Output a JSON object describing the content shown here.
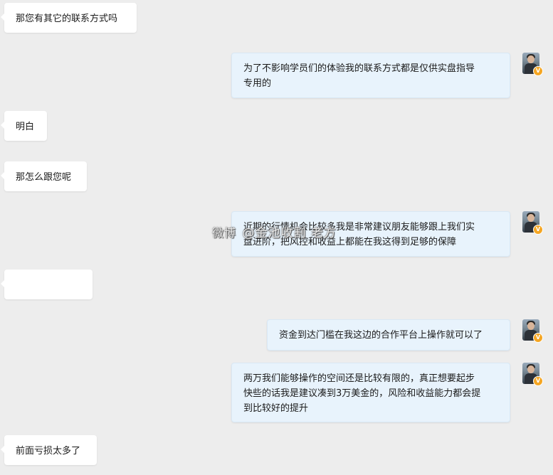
{
  "messages": [
    {
      "side": "in",
      "text": "那您有其它的联系方式吗"
    },
    {
      "side": "out",
      "text_lines": [
        "为了不影响学员们的体验我的联系方式都是仅供实盘指导",
        "专用的"
      ]
    },
    {
      "side": "in",
      "text": "明白"
    },
    {
      "side": "in",
      "text": "那怎么跟您呢"
    },
    {
      "side": "out",
      "text_lines": [
        "近期的行情机会比较多我是非常建议朋友能够跟上我们实",
        "盘进阶，把风控和收益上都能在我这得到足够的保障"
      ]
    },
    {
      "side": "in",
      "text": ""
    },
    {
      "side": "out",
      "text": "资金到达门槛在我这边的合作平台上操作就可以了"
    },
    {
      "side": "out",
      "text_lines": [
        "两万我们能够操作的空间还是比较有限的，真正想要起步",
        "快些的话我是建议凑到3万美金的，风险和收益能力都会提",
        "到比较好的提升"
      ]
    },
    {
      "side": "in",
      "text": "前面亏损太多了"
    }
  ],
  "avatar_badge": "V",
  "watermark": {
    "logo": "微博",
    "text": "@金池收割 老方"
  }
}
